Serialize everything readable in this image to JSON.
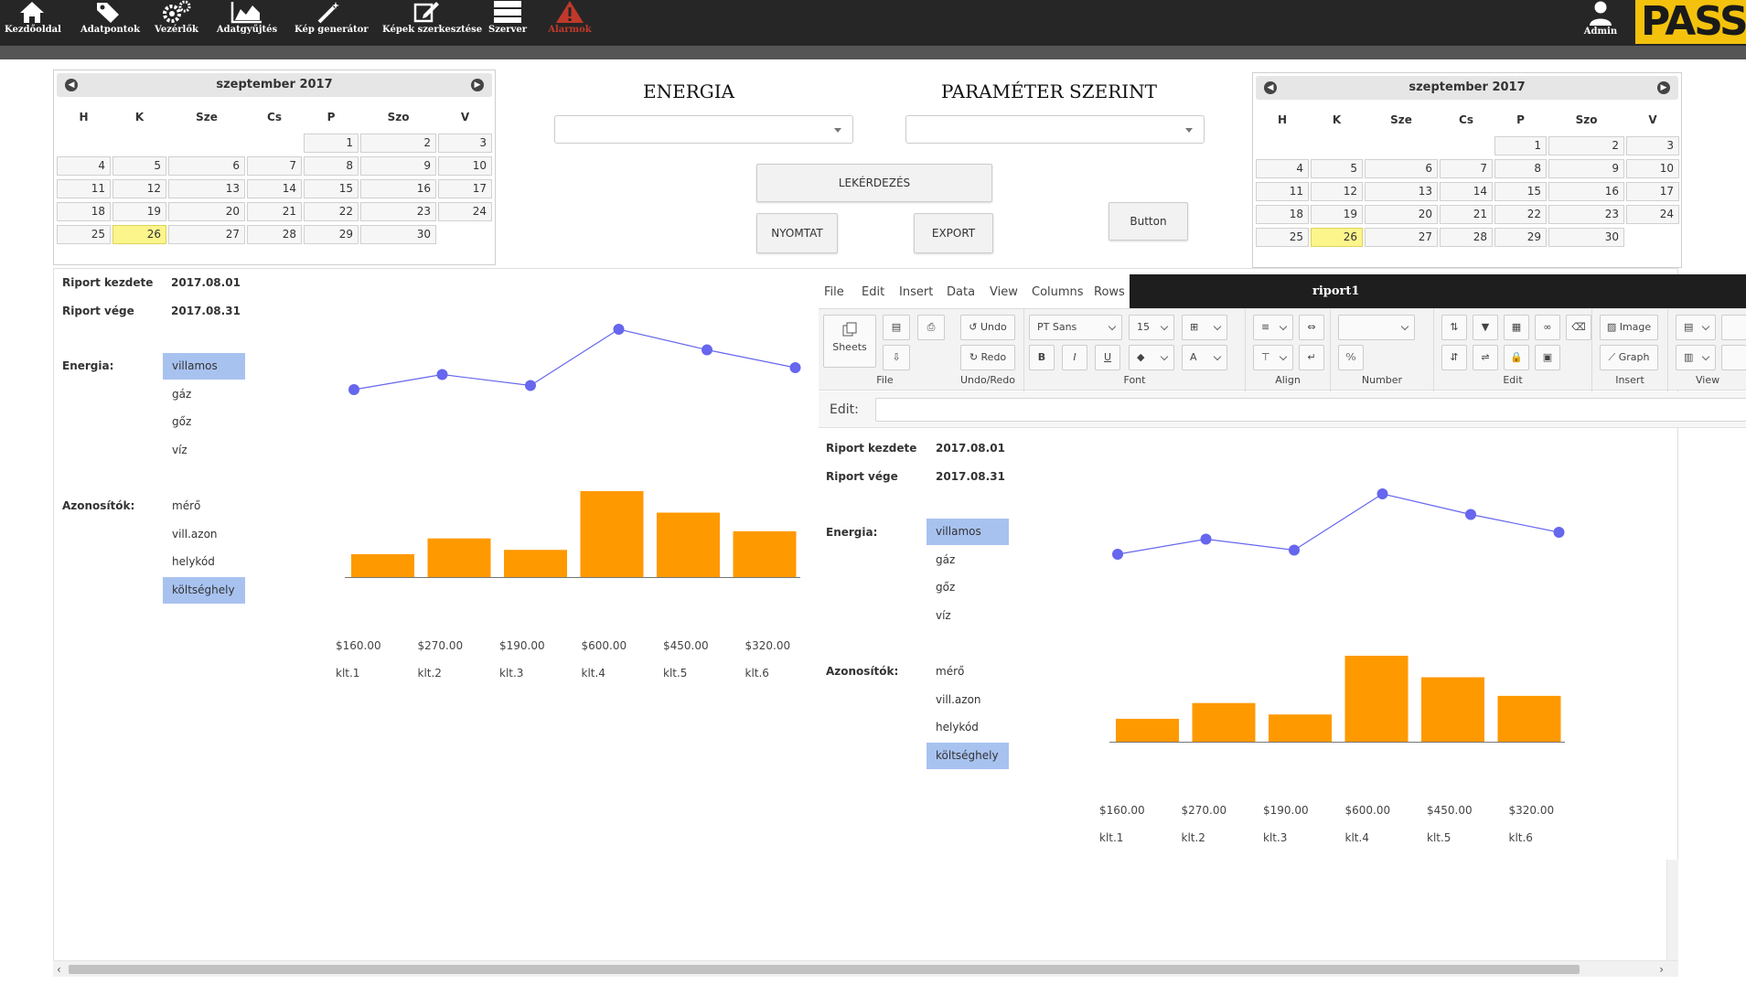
{
  "nav": {
    "items": [
      {
        "label": "Kezdőoldal",
        "icon": "home-icon"
      },
      {
        "label": "Adatpontok",
        "icon": "tag-icon"
      },
      {
        "label": "Vezérlők",
        "icon": "gears-icon"
      },
      {
        "label": "Adatgyűjtés",
        "icon": "area-chart-icon"
      },
      {
        "label": "Kép generátor",
        "icon": "magic-wand-icon"
      },
      {
        "label": "Képek szerkesztése",
        "icon": "edit-icon"
      },
      {
        "label": "Szerver",
        "icon": "server-icon"
      },
      {
        "label": "Alarmok",
        "icon": "warning-icon"
      }
    ],
    "admin": {
      "label": "Admin",
      "icon": "user-icon"
    },
    "logo": "PASS",
    "colors": {
      "bar": "#262626",
      "alarm": "#c0392b",
      "logo_bg": "#f4c20d"
    }
  },
  "calendar_left": {
    "title": "szeptember 2017",
    "days": [
      "H",
      "K",
      "Sze",
      "Cs",
      "P",
      "Szo",
      "V"
    ],
    "weeks": [
      [
        "",
        "",
        "",
        "",
        "1",
        "2",
        "3"
      ],
      [
        "4",
        "5",
        "6",
        "7",
        "8",
        "9",
        "10"
      ],
      [
        "11",
        "12",
        "13",
        "14",
        "15",
        "16",
        "17"
      ],
      [
        "18",
        "19",
        "20",
        "21",
        "22",
        "23",
        "24"
      ],
      [
        "25",
        "26",
        "27",
        "28",
        "29",
        "30",
        ""
      ]
    ],
    "today": "26"
  },
  "calendar_right": {
    "title": "szeptember 2017",
    "days": [
      "H",
      "K",
      "Sze",
      "Cs",
      "P",
      "Szo",
      "V"
    ],
    "weeks": [
      [
        "",
        "",
        "",
        "",
        "1",
        "2",
        "3"
      ],
      [
        "4",
        "5",
        "6",
        "7",
        "8",
        "9",
        "10"
      ],
      [
        "11",
        "12",
        "13",
        "14",
        "15",
        "16",
        "17"
      ],
      [
        "18",
        "19",
        "20",
        "21",
        "22",
        "23",
        "24"
      ],
      [
        "25",
        "26",
        "27",
        "28",
        "29",
        "30",
        ""
      ]
    ],
    "today": "26"
  },
  "controls": {
    "energia_title": "ENERGIA",
    "param_title": "PARAMÉTER SZERINT",
    "energia_value": "",
    "param_value": "",
    "query_button": "LEKÉRDEZÉS",
    "print_button": "NYOMTAT",
    "export_button": "EXPORT",
    "generic_button": "Button"
  },
  "report_left": {
    "start_label": "Riport kezdete",
    "start_value": "2017.08.01",
    "end_label": "Riport vége",
    "end_value": "2017.08.31",
    "energy_label": "Energia:",
    "energy_options": [
      "villamos",
      "gáz",
      "gőz",
      "víz"
    ],
    "energy_selected": "villamos",
    "ids_label": "Azonosítók:",
    "id_options": [
      "mérő",
      "vill.azon",
      "helykód",
      "költséghely"
    ],
    "id_selected": "költséghely"
  },
  "spreadsheet": {
    "menus": [
      "File",
      "Edit",
      "Insert",
      "Data",
      "View",
      "Columns",
      "Rows"
    ],
    "tab_title": "riport1",
    "groups": [
      "File",
      "Undo/Redo",
      "Font",
      "Align",
      "Number",
      "Edit",
      "Insert",
      "View"
    ],
    "sheets_label": "Sheets",
    "undo_label": "Undo",
    "redo_label": "Redo",
    "font_family": "PT Sans",
    "font_size": "15",
    "image_label": "Image",
    "graph_label": "Graph",
    "edit_label": "Edit:",
    "edit_value": ""
  },
  "report_right": {
    "start_label": "Riport kezdete",
    "start_value": "2017.08.01",
    "end_label": "Riport vége",
    "end_value": "2017.08.31",
    "energy_label": "Energia:",
    "energy_options": [
      "villamos",
      "gáz",
      "gőz",
      "víz"
    ],
    "energy_selected": "villamos",
    "ids_label": "Azonosítók:",
    "id_options": [
      "mérő",
      "vill.azon",
      "helykód",
      "költséghely"
    ],
    "id_selected": "költséghely"
  },
  "chart_data": [
    {
      "type": "line",
      "categories": [
        "klt.1",
        "klt.2",
        "klt.3",
        "klt.4",
        "klt.5",
        "klt.6"
      ],
      "values": [
        160,
        270,
        190,
        600,
        450,
        320
      ],
      "color": "#6666ee"
    },
    {
      "type": "bar",
      "categories": [
        "klt.1",
        "klt.2",
        "klt.3",
        "klt.4",
        "klt.5",
        "klt.6"
      ],
      "values": [
        160,
        270,
        190,
        600,
        450,
        320
      ],
      "value_labels": [
        "$160.00",
        "$270.00",
        "$190.00",
        "$600.00",
        "$450.00",
        "$320.00"
      ],
      "color": "#ff9900"
    }
  ]
}
